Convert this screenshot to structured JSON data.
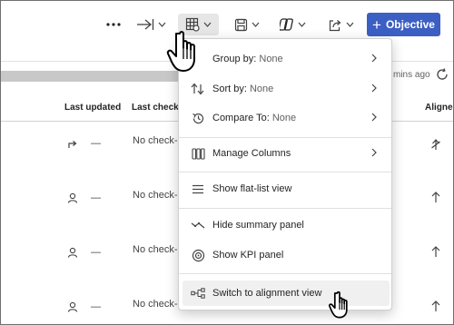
{
  "toolbar": {
    "more_icon": "more-horizontal-icon",
    "objective_label": "Objective",
    "objective_plus": "+"
  },
  "status": {
    "updated_text": "mins ago"
  },
  "table": {
    "headers": [
      "Last updated",
      "Last check-i",
      "Aligne"
    ],
    "rows": [
      {
        "dash": "—",
        "checkin": "No check-"
      },
      {
        "dash": "—",
        "checkin": "No check-"
      },
      {
        "dash": "—",
        "checkin": "No check-"
      },
      {
        "dash": "—",
        "checkin": "No check-"
      }
    ]
  },
  "menu": {
    "group_by": {
      "label": "Group by:",
      "value": "None"
    },
    "sort_by": {
      "label": "Sort by:",
      "value": "None"
    },
    "compare_to": {
      "label": "Compare To:",
      "value": "None"
    },
    "manage_columns": "Manage Columns",
    "flat_list": "Show flat-list view",
    "hide_summary": "Hide summary panel",
    "show_kpi": "Show KPI panel",
    "switch_alignment": "Switch to alignment view"
  },
  "colors": {
    "accent": "#3c5fc4",
    "hover": "#f0f0f0"
  }
}
